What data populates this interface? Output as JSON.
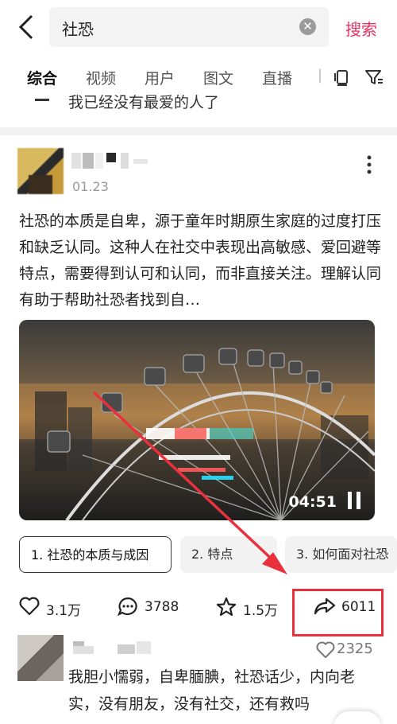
{
  "search": {
    "query": "社恐",
    "button_label": "搜索"
  },
  "tabs": [
    "综合",
    "视频",
    "用户",
    "图文",
    "直播"
  ],
  "previous_item": {
    "text": "我已经没有最爱的人了"
  },
  "post": {
    "date": "01.23",
    "text": "社恐的本质是自卑，源于童年时期原生家庭的过度打压和缺乏认同。这种人在社交中表现出高敏感、爱回避等特点，需要得到认可和认同，而非直接关注。理解认同有助于帮助社恐者找到自…",
    "video_duration": "04:51",
    "chapters": [
      "1. 社恐的本质与成因",
      "2. 特点",
      "3. 如何面对社恐"
    ],
    "likes": "3.1万",
    "comments": "3788",
    "favorites": "1.5万",
    "shares": "6011"
  },
  "comment": {
    "likes": "2325",
    "text": "我胆小懦弱，自卑腼腆，社恐话少，内向老实，没有朋友，没有社交，还有救吗"
  },
  "colors": {
    "accent": "#e23465",
    "highlight": "#e8313d"
  }
}
